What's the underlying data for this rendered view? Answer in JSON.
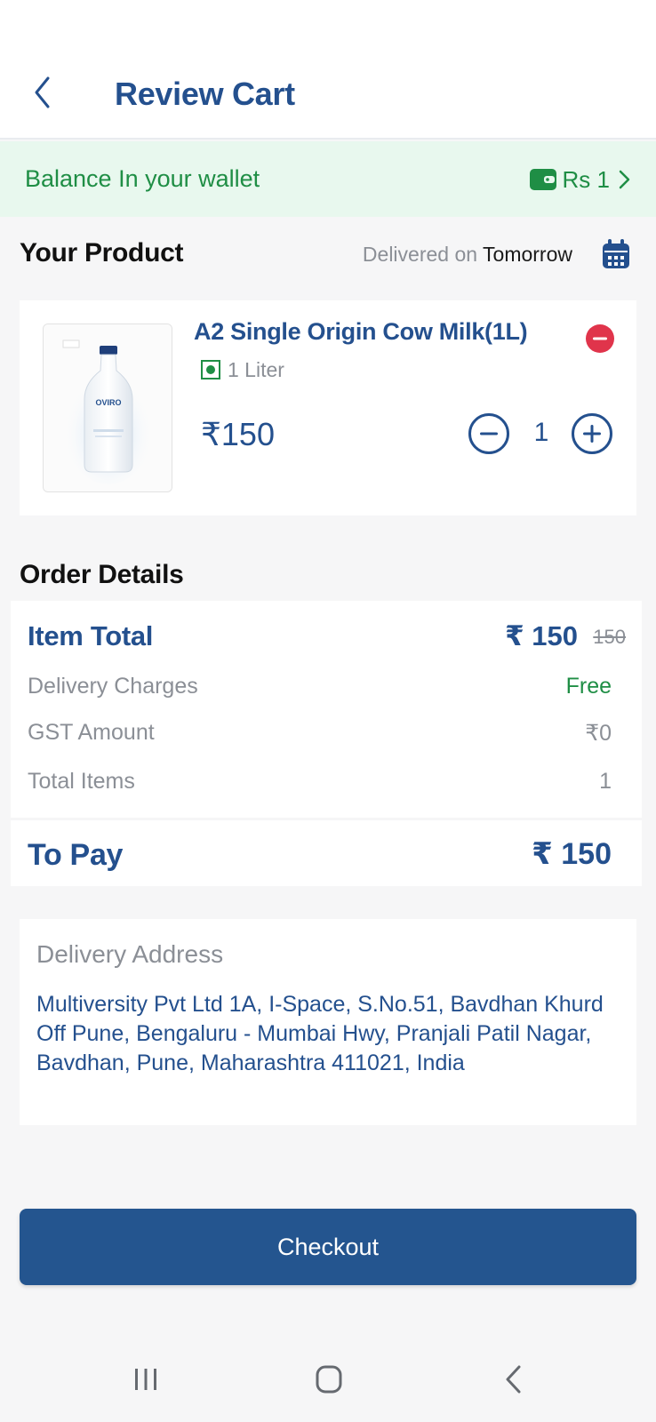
{
  "header": {
    "title": "Review Cart",
    "back_icon": "chevron-left-icon"
  },
  "wallet": {
    "label": "Balance In your wallet",
    "amount": "Rs 1",
    "icon": "wallet-icon"
  },
  "product_section": {
    "title": "Your Product",
    "delivered_prefix": "Delivered on ",
    "delivered_day": "Tomorrow"
  },
  "product": {
    "name": "A2 Single Origin Cow Milk(1L)",
    "variant": "1 Liter",
    "price": "₹150",
    "quantity": "1",
    "image_brand": "OVIRO"
  },
  "order_details": {
    "title": "Order Details",
    "item_total_label": "Item Total",
    "item_total_value": "₹ 150",
    "item_total_original": "150",
    "delivery_label": "Delivery Charges",
    "delivery_value": "Free",
    "gst_label": "GST Amount",
    "gst_value": "₹0",
    "total_items_label": "Total Items",
    "total_items_value": "1",
    "to_pay_label": "To Pay",
    "to_pay_value": "₹ 150"
  },
  "address": {
    "title": "Delivery Address",
    "text": "Multiversity Pvt Ltd 1A, I-Space, S.No.51, Bavdhan Khurd Off Pune, Bengaluru - Mumbai Hwy, Pranjali Patil Nagar, Bavdhan, Pune, Maharashtra 411021, India"
  },
  "checkout_label": "Checkout",
  "colors": {
    "brand_blue": "#24508e",
    "green": "#1f8e45",
    "remove_red": "#e0344b",
    "wallet_bg": "#e8f8ee"
  }
}
